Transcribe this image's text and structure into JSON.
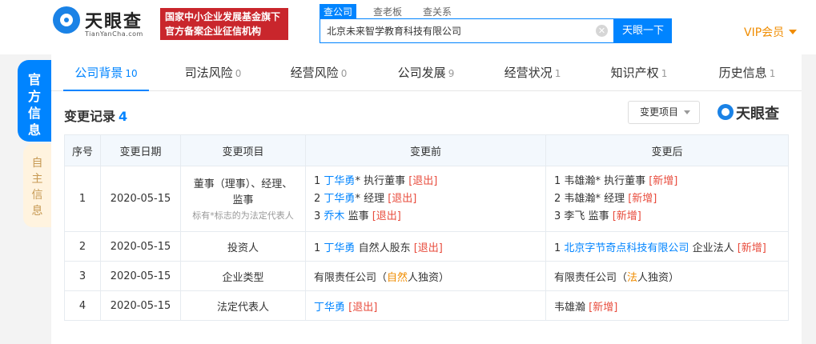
{
  "header": {
    "logo_cn": "天眼查",
    "logo_en": "TianYanCha.com",
    "banner_line1": "国家中小企业发展基金旗下",
    "banner_line2": "官方备案企业征信机构",
    "search_tabs": [
      "查公司",
      "查老板",
      "查关系"
    ],
    "search_value": "北京未来智学教育科技有限公司",
    "search_button": "天眼一下",
    "vip_label": "VIP会员"
  },
  "side_tabs": [
    {
      "label": "官方信息"
    },
    {
      "label": "自主信息"
    }
  ],
  "tabs": [
    {
      "label": "公司背景",
      "count": "10"
    },
    {
      "label": "司法风险",
      "count": "0"
    },
    {
      "label": "经营风险",
      "count": "0"
    },
    {
      "label": "公司发展",
      "count": "9"
    },
    {
      "label": "经营状况",
      "count": "1"
    },
    {
      "label": "知识产权",
      "count": "1"
    },
    {
      "label": "历史信息",
      "count": "1"
    }
  ],
  "section": {
    "title": "变更记录",
    "count": "4",
    "filter_label": "变更项目",
    "watermark": "天眼查"
  },
  "table": {
    "headers": [
      "序号",
      "变更日期",
      "变更项目",
      "变更前",
      "变更后"
    ],
    "rows": [
      {
        "no": "1",
        "date": "2020-05-15",
        "item": "董事（理事）、经理、监事",
        "item_note": "标有*标志的为法定代表人",
        "before": [
          {
            "idx": "1",
            "name": "丁华勇",
            "suffix": "* 执行董事",
            "tag": "[退出]"
          },
          {
            "idx": "2",
            "name": "丁华勇",
            "suffix": "* 经理",
            "tag": "[退出]"
          },
          {
            "idx": "3",
            "name": "乔木",
            "suffix": " 监事",
            "tag": "[退出]"
          }
        ],
        "after": [
          {
            "idx": "1",
            "name": "韦雄瀚",
            "suffix": "* 执行董事",
            "tag": "[新增]"
          },
          {
            "idx": "2",
            "name": "韦雄瀚",
            "suffix": "* 经理",
            "tag": "[新增]"
          },
          {
            "idx": "3",
            "name": "李飞",
            "suffix": " 监事",
            "tag": "[新增]"
          }
        ]
      },
      {
        "no": "2",
        "date": "2020-05-15",
        "item": "投资人",
        "before": {
          "idx": "1",
          "name": "丁华勇",
          "suffix": " 自然人股东",
          "tag": "[退出]"
        },
        "after": {
          "idx": "1",
          "name": "北京字节奇点科技有限公司",
          "suffix": " 企业法人",
          "tag": "[新增]"
        }
      },
      {
        "no": "3",
        "date": "2020-05-15",
        "item": "企业类型",
        "before": {
          "p1": "有限责任公司（",
          "hl": "自然",
          "p2": "人独资）"
        },
        "after": {
          "p1": "有限责任公司（",
          "hl": "法",
          "p2": "人独资）"
        }
      },
      {
        "no": "4",
        "date": "2020-05-15",
        "item": "法定代表人",
        "before": {
          "name": "丁华勇",
          "tag": "[退出]"
        },
        "after": {
          "name": "韦雄瀚",
          "tag": "[新增]"
        }
      }
    ]
  }
}
